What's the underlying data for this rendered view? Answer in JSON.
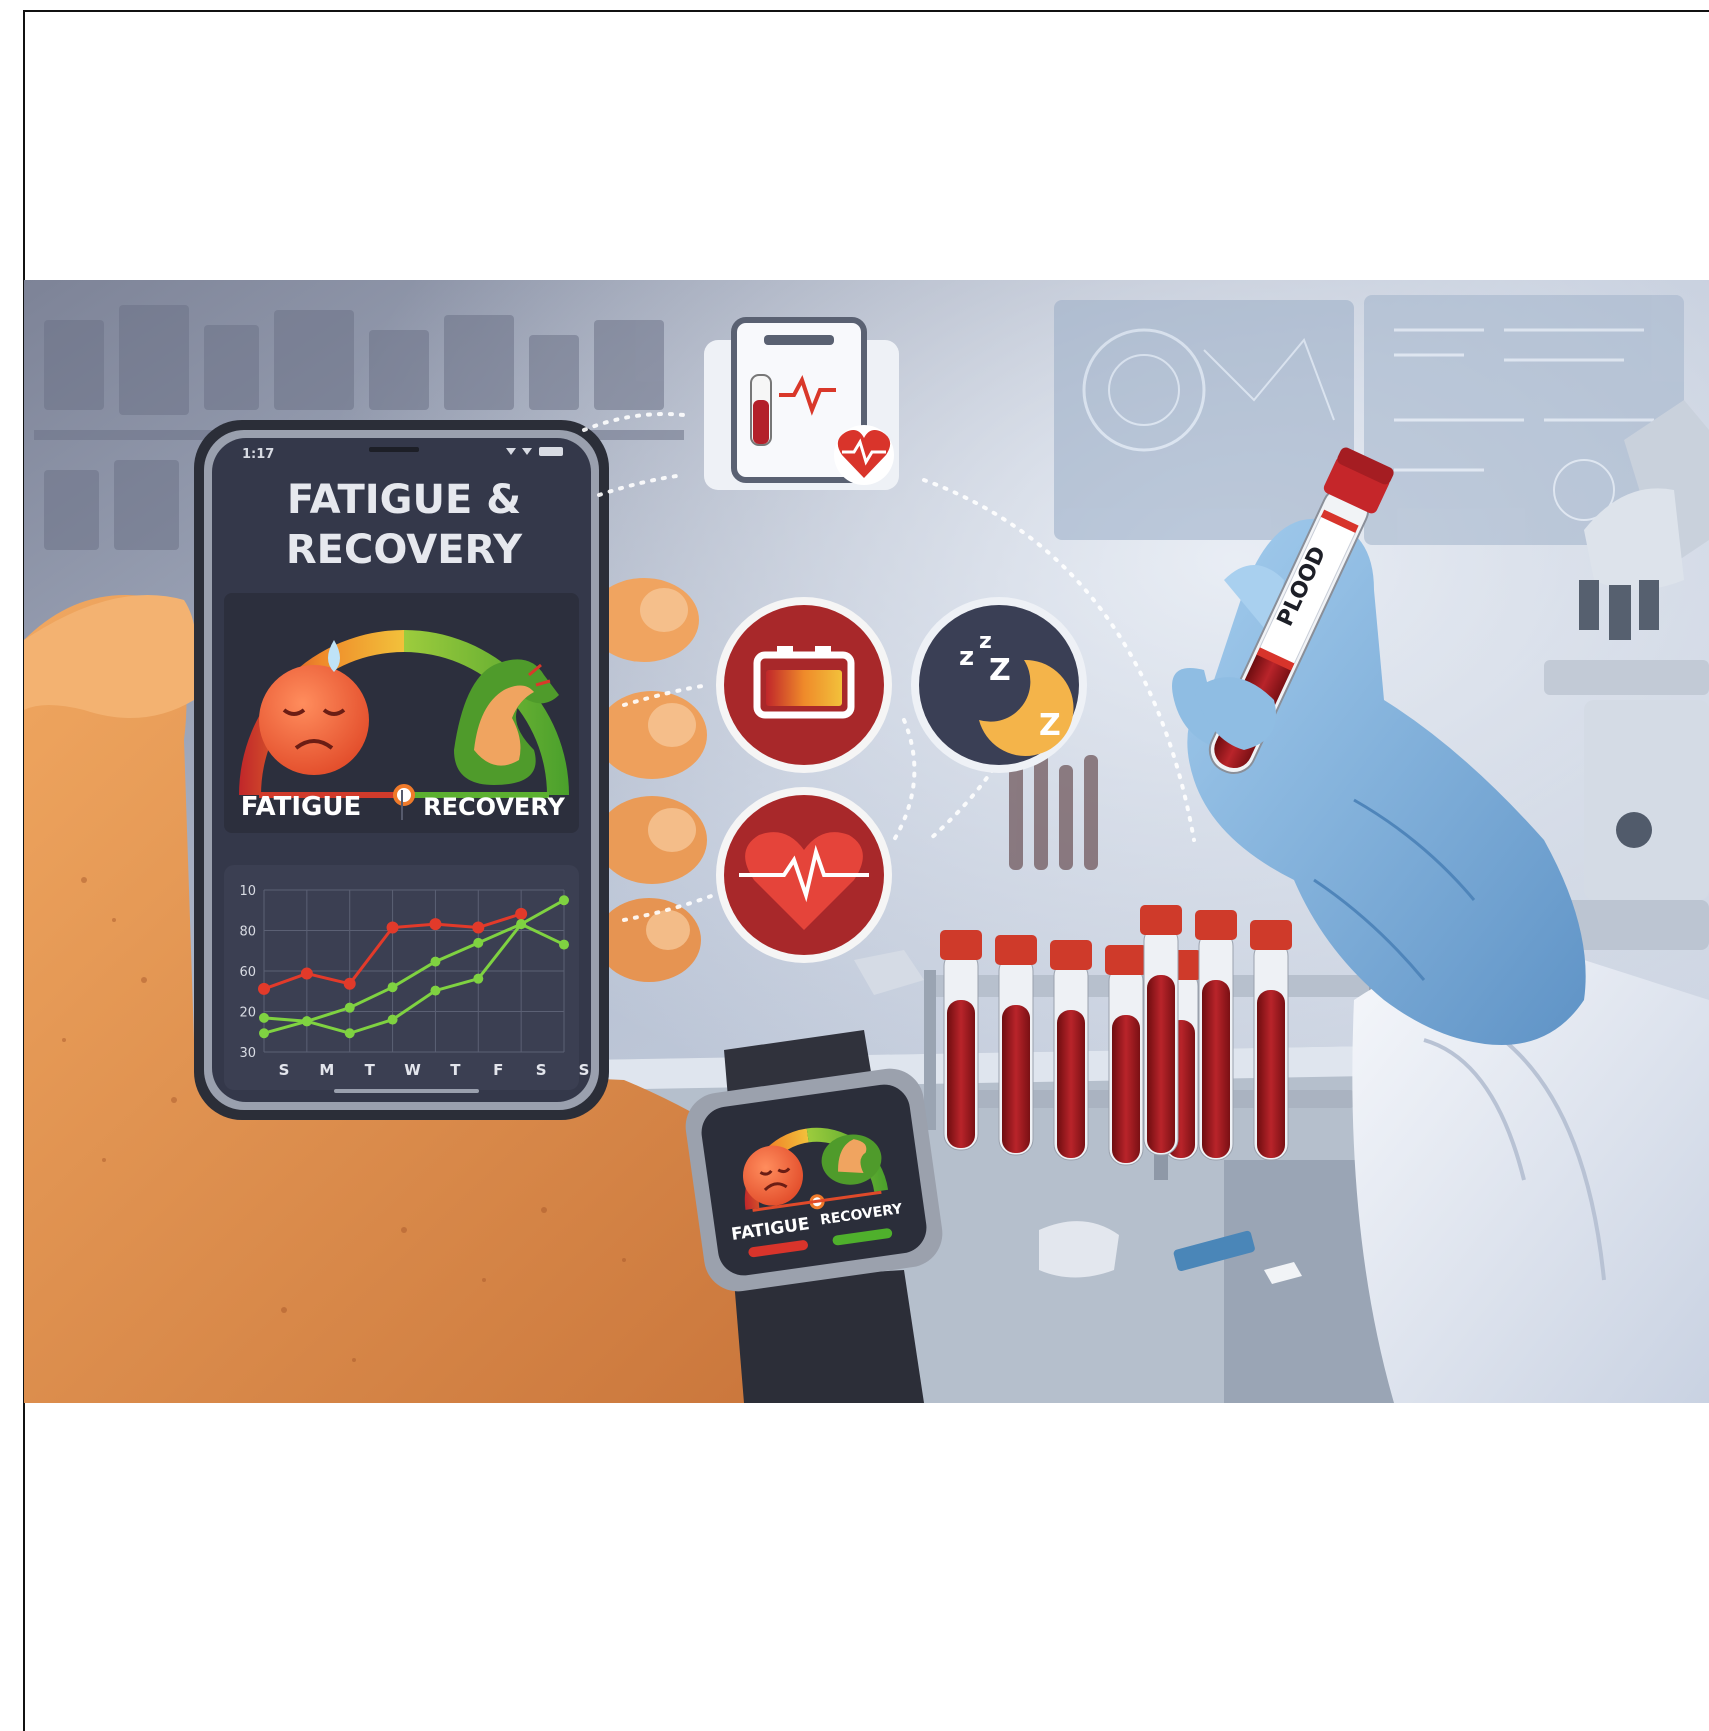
{
  "phone": {
    "status_time": "1:17",
    "title_line1": "FATIGUE &",
    "title_line2": "RECOVERY",
    "fatigue_label": "FATIGUE",
    "recovery_label": "RECOVERY",
    "gauge_level": 0.5
  },
  "chart_data": {
    "type": "line",
    "categories": [
      "S",
      "M",
      "T",
      "W",
      "T",
      "F",
      "S",
      "S"
    ],
    "y_tick_labels": [
      "10",
      "80",
      "60",
      "20",
      "30"
    ],
    "series": [
      {
        "color": "#e23a2a",
        "values": [
          57,
          66,
          60,
          93,
          95,
          93,
          101,
          null
        ]
      },
      {
        "color": "#7fd241",
        "values": [
          40,
          38,
          46,
          58,
          73,
          84,
          95,
          83
        ]
      },
      {
        "color": "#7fd241",
        "values": [
          31,
          38,
          31,
          39,
          56,
          63,
          95,
          109
        ]
      }
    ],
    "grid": true
  },
  "watch": {
    "fatigue_label": "FATIGUE",
    "recovery_label": "RECOVERY"
  },
  "tube": {
    "label": "PLOOD"
  },
  "icons": [
    "clipboard-blood-report-icon",
    "battery-icon",
    "sleep-moon-icon",
    "heart-rate-icon"
  ],
  "colors": {
    "fatigue_red": "#d9382a",
    "recovery_green": "#5cb030",
    "phone_screen": "#34384a",
    "icon_circle": "#a8282a",
    "glove_blue": "#7fb2dc"
  }
}
